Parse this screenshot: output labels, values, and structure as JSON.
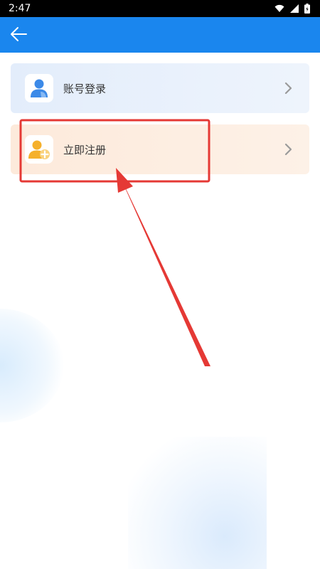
{
  "status_bar": {
    "time": "2:47",
    "icons": [
      "wifi-icon",
      "signal-icon",
      "battery-icon"
    ]
  },
  "app_bar": {
    "back_icon": "arrow-left-icon",
    "color": "#1a86ee"
  },
  "menu": [
    {
      "label": "账号登录",
      "icon": "user-icon",
      "accent": "#3c8ae8"
    },
    {
      "label": "立即注册",
      "icon": "user-add-icon",
      "accent": "#f5b02b"
    }
  ],
  "annotation": {
    "color": "#e53935"
  }
}
